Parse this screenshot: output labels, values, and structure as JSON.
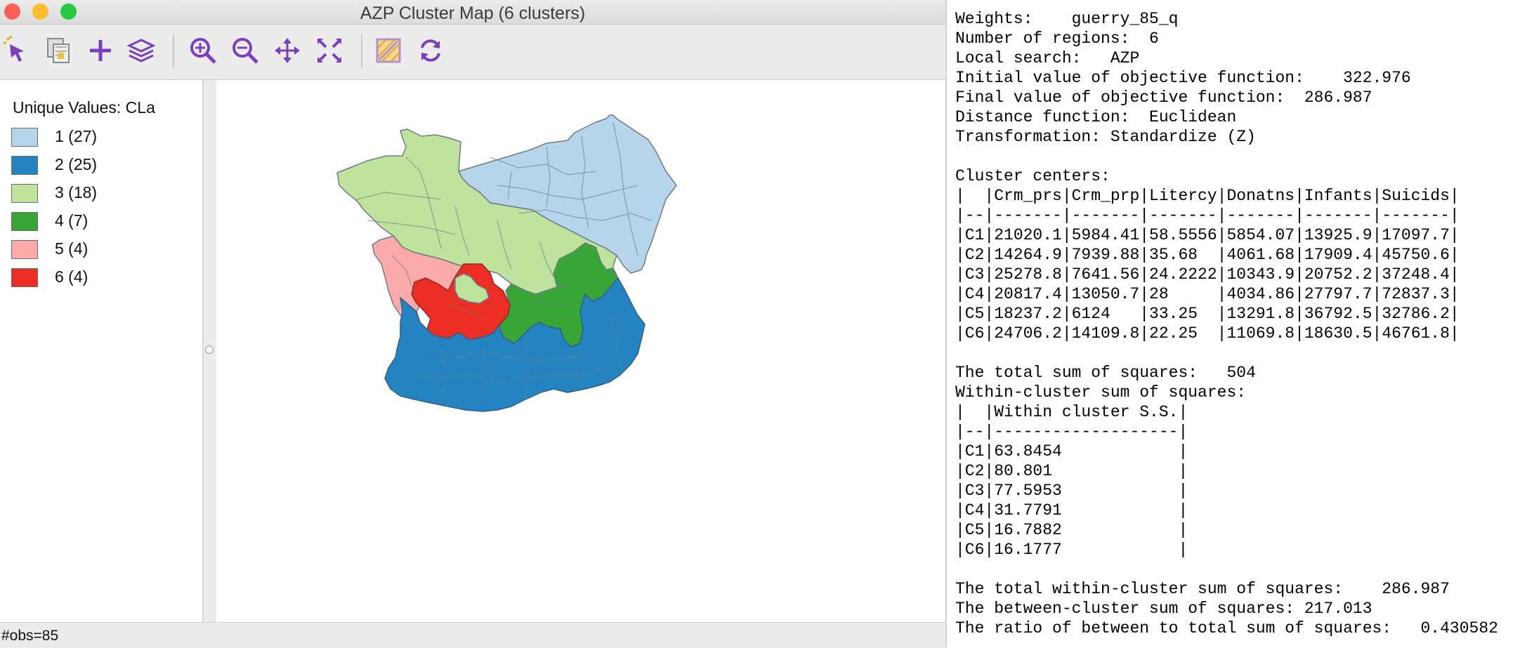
{
  "window": {
    "title": "AZP Cluster Map (6 clusters)",
    "traffic_lights": {
      "close": "#fe5f57",
      "minimize": "#febc2e",
      "zoom": "#28c840"
    }
  },
  "toolbar": {
    "accent_color": "#7a3fc1",
    "icons": [
      "select-icon",
      "copy-map-icon",
      "add-icon",
      "layers-icon",
      "zoom-in-icon",
      "zoom-out-icon",
      "pan-icon",
      "fit-extent-icon",
      "map-basemap-icon",
      "refresh-icon"
    ]
  },
  "legend": {
    "title": "Unique Values: CLa",
    "items": [
      {
        "label": "1 (27)",
        "color": "#b4d5ea"
      },
      {
        "label": "2 (25)",
        "color": "#2484c1"
      },
      {
        "label": "3 (18)",
        "color": "#bde39c"
      },
      {
        "label": "4 (7)",
        "color": "#37a636"
      },
      {
        "label": "5 (4)",
        "color": "#fcaaa9"
      },
      {
        "label": "6 (4)",
        "color": "#ec2e24"
      }
    ]
  },
  "map": {
    "name": "cluster-map-of-france",
    "boundary_color": "#707a85"
  },
  "status": {
    "text": "#obs=85"
  },
  "console": {
    "lines": [
      "------",
      "Weights:    guerry_85_q",
      "Number of regions:  6",
      "Local search:   AZP",
      "Initial value of objective function:    322.976",
      "Final value of objective function:  286.987",
      "Distance function:  Euclidean",
      "Transformation: Standardize (Z)",
      "",
      "Cluster centers:",
      "|  |Crm_prs|Crm_prp|Litercy|Donatns|Infants|Suicids|",
      "|--|-------|-------|-------|-------|-------|-------|",
      "|C1|21020.1|5984.41|58.5556|5854.07|13925.9|17097.7|",
      "|C2|14264.9|7939.88|35.68  |4061.68|17909.4|45750.6|",
      "|C3|25278.8|7641.56|24.2222|10343.9|20752.2|37248.4|",
      "|C4|20817.4|13050.7|28     |4034.86|27797.7|72837.3|",
      "|C5|18237.2|6124   |33.25  |13291.8|36792.5|32786.2|",
      "|C6|24706.2|14109.8|22.25  |11069.8|18630.5|46761.8|",
      "",
      "The total sum of squares:   504",
      "Within-cluster sum of squares:",
      "|  |Within cluster S.S.|",
      "|--|-------------------|",
      "|C1|63.8454            |",
      "|C2|80.801             |",
      "|C3|77.5953            |",
      "|C4|31.7791            |",
      "|C5|16.7882            |",
      "|C6|16.1777            |",
      "",
      "The total within-cluster sum of squares:    286.987",
      "The between-cluster sum of squares: 217.013",
      "The ratio of between to total sum of squares:   0.430582"
    ]
  }
}
